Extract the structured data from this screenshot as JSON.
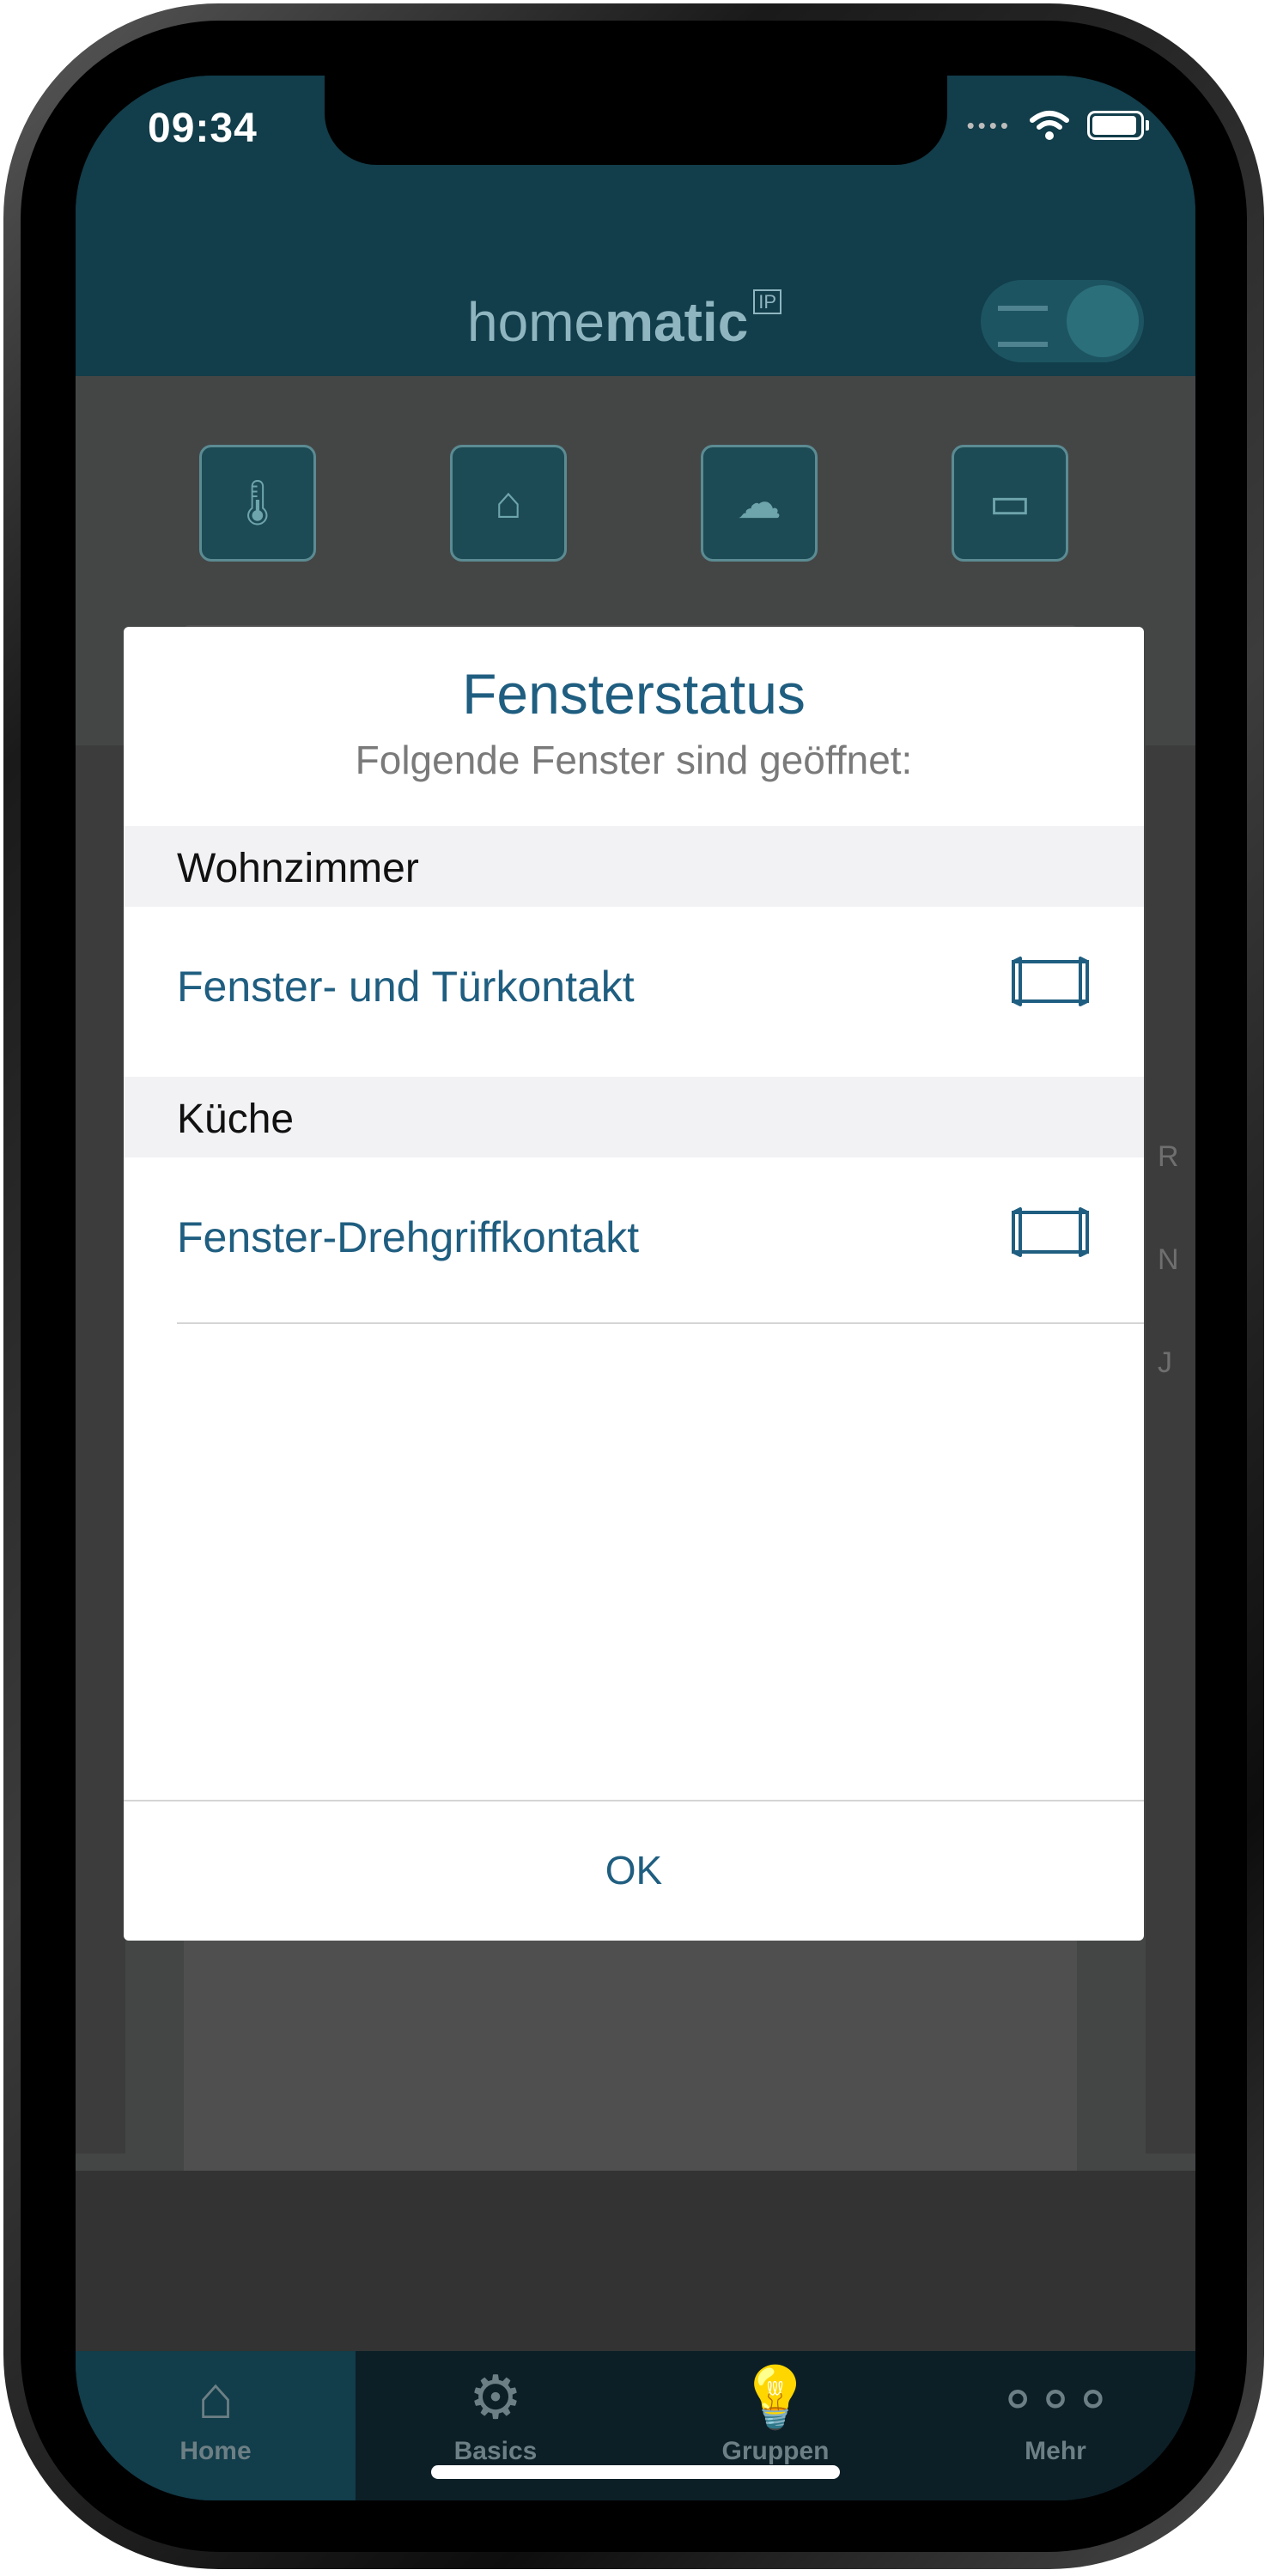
{
  "status_bar": {
    "time": "09:34",
    "signal_dots": "••••"
  },
  "app_header": {
    "logo_light": "home",
    "logo_bold": "matic",
    "logo_badge": "IP"
  },
  "feature_icons": [
    {
      "name": "thermometer-icon"
    },
    {
      "name": "house-info-icon"
    },
    {
      "name": "cloud-icon"
    },
    {
      "name": "window-icon"
    }
  ],
  "dialog": {
    "title": "Fensterstatus",
    "subtitle": "Folgende Fenster sind geöffnet:",
    "sections": [
      {
        "room": "Wohnzimmer",
        "items": [
          {
            "label": "Fenster- und Türkontakt",
            "icon": "window-open-icon"
          }
        ]
      },
      {
        "room": "Küche",
        "items": [
          {
            "label": "Fenster-Drehgriffkontakt",
            "icon": "window-open-icon"
          }
        ]
      }
    ],
    "ok_label": "OK"
  },
  "tabbar": {
    "tabs": [
      {
        "label": "Home",
        "icon": "home-icon",
        "active": true
      },
      {
        "label": "Basics",
        "icon": "gear-play-icon",
        "active": false
      },
      {
        "label": "Gruppen",
        "icon": "bulb-icon",
        "active": false
      },
      {
        "label": "Mehr",
        "icon": "more-dots-icon",
        "active": false
      }
    ]
  },
  "colors": {
    "accent": "#1f5e80",
    "header_bg": "#123d4a",
    "tabbar_bg": "#0c1f27"
  }
}
